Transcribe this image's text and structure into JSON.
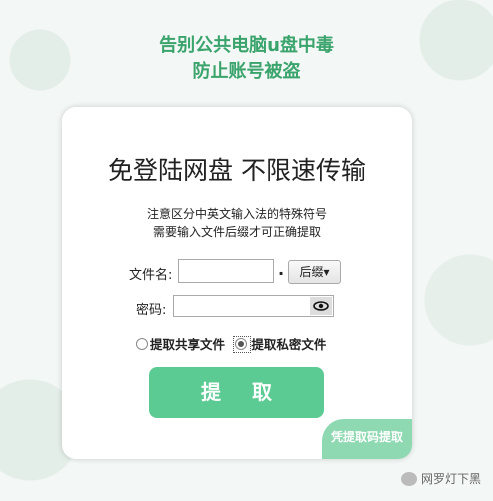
{
  "headline": {
    "line1": "告别公共电脑u盘中毒",
    "line2": "防止账号被盗"
  },
  "card": {
    "title": "免登陆网盘 不限速传输",
    "notice_line1": "注意区分中英文输入法的特殊符号",
    "notice_line2": "需要输入文件后缀才可正确提取"
  },
  "form": {
    "filename_label": "文件名:",
    "filename_value": "",
    "dot": ".",
    "suffix_button": "后缀▾",
    "password_label": "密码:",
    "password_value": ""
  },
  "radios": {
    "shared_label": "提取共享文件",
    "private_label": "提取私密文件",
    "selected": "private"
  },
  "submit_label": "提 取",
  "corner_label": "凭提取码提取",
  "footer": {
    "text": "网罗灯下黑"
  },
  "colors": {
    "accent": "#5ccb93",
    "headline": "#3aa46c"
  }
}
